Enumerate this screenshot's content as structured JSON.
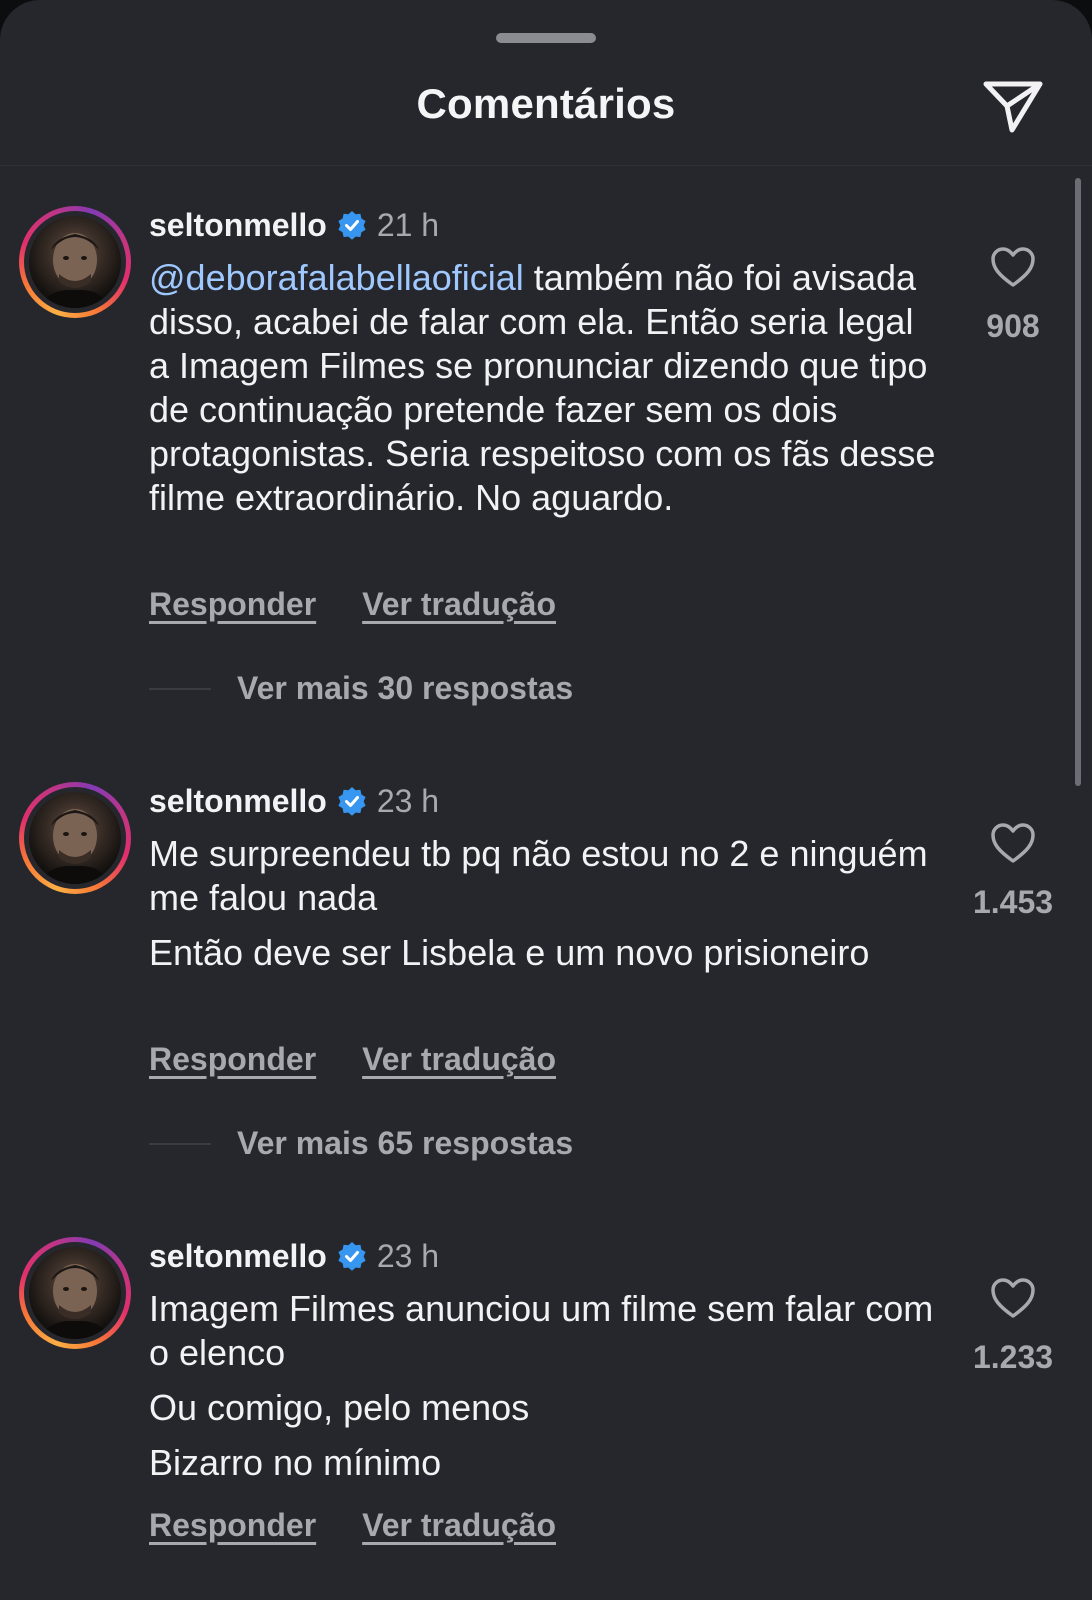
{
  "header": {
    "title": "Comentários"
  },
  "comments": [
    {
      "username": "seltonmello",
      "time": "21 h",
      "mention": "@deborafalabellaoficial",
      "text_after_mention": " também não foi avisada disso, acabei de falar com ela. Então seria legal a Imagem Filmes se pronunciar dizendo que tipo de continuação pretende fazer sem os dois protagonistas. Seria respeitoso com os fãs desse filme extraordinário. No aguardo.",
      "reply_label": "Responder",
      "translate_label": "Ver tradução",
      "likes": "908",
      "more_replies": "Ver mais 30 respostas"
    },
    {
      "username": "seltonmello",
      "time": "23 h",
      "paragraph1": "Me surpreendeu tb pq não estou no 2 e ninguém me falou nada",
      "paragraph2": "Então deve ser Lisbela e um novo prisioneiro",
      "reply_label": "Responder",
      "translate_label": "Ver tradução",
      "likes": "1.453",
      "more_replies": "Ver mais 65 respostas"
    },
    {
      "username": "seltonmello",
      "time": "23 h",
      "paragraph1": "Imagem Filmes anunciou um filme sem falar com o elenco",
      "paragraph2": "Ou comigo, pelo menos",
      "paragraph3": "Bizarro no mínimo",
      "reply_label": "Responder",
      "translate_label": "Ver tradução",
      "likes": "1.233"
    }
  ],
  "colors": {
    "background": "#25272c",
    "mention": "#9fc8ff",
    "verified": "#3797f0",
    "secondary_text": "#a7a9ae"
  },
  "icons": {
    "share": "paper-plane-icon",
    "like": "heart-outline-icon",
    "verified": "verified-badge-icon"
  }
}
